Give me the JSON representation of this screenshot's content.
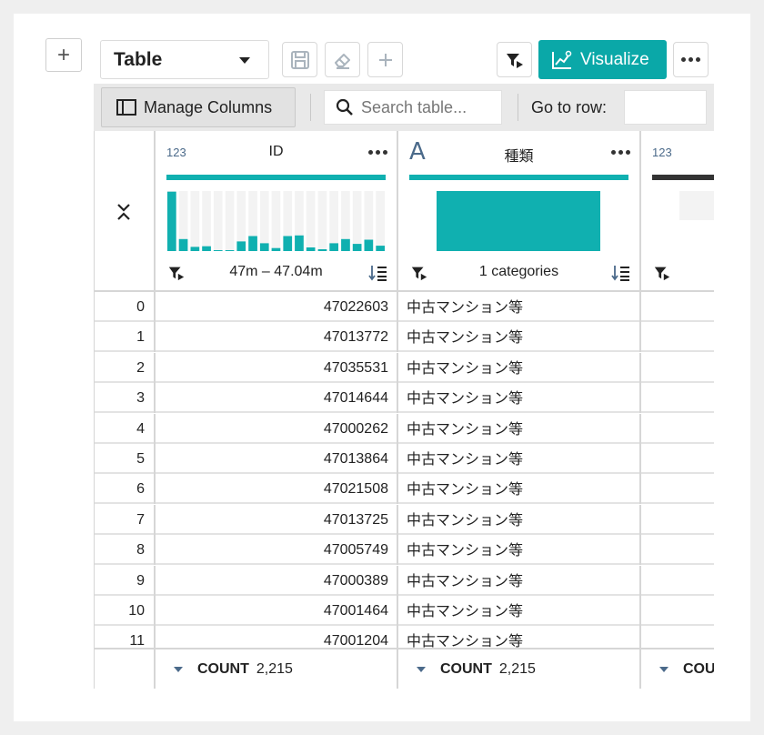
{
  "toolbar": {
    "add_cell_label": "+",
    "view_select": {
      "value": "Table"
    },
    "visualize_label": "Visualize"
  },
  "table_toolbar": {
    "manage_columns_label": "Manage Columns",
    "search_placeholder": "Search table...",
    "goto_label": "Go to row:",
    "goto_value": ""
  },
  "columns": [
    {
      "type_label": "123",
      "name": "ID",
      "summary": "47m – 47.04m",
      "histogram": [
        0.99,
        0.2,
        0.07,
        0.08,
        0.0,
        0.0,
        0.16,
        0.25,
        0.13,
        0.05,
        0.25,
        0.26,
        0.06,
        0.03,
        0.13,
        0.2,
        0.12,
        0.19,
        0.09
      ]
    },
    {
      "type_label": "A",
      "name": "種類",
      "summary": "1 categories"
    },
    {
      "type_label": "123"
    }
  ],
  "rows": [
    {
      "index": "0",
      "id": "47022603",
      "kind": "中古マンション等"
    },
    {
      "index": "1",
      "id": "47013772",
      "kind": "中古マンション等"
    },
    {
      "index": "2",
      "id": "47035531",
      "kind": "中古マンション等"
    },
    {
      "index": "3",
      "id": "47014644",
      "kind": "中古マンション等"
    },
    {
      "index": "4",
      "id": "47000262",
      "kind": "中古マンション等"
    },
    {
      "index": "5",
      "id": "47013864",
      "kind": "中古マンション等"
    },
    {
      "index": "6",
      "id": "47021508",
      "kind": "中古マンション等"
    },
    {
      "index": "7",
      "id": "47013725",
      "kind": "中古マンション等"
    },
    {
      "index": "8",
      "id": "47005749",
      "kind": "中古マンション等"
    },
    {
      "index": "9",
      "id": "47000389",
      "kind": "中古マンション等"
    },
    {
      "index": "10",
      "id": "47001464",
      "kind": "中古マンション等"
    },
    {
      "index": "11",
      "id": "47001204",
      "kind": "中古マンション等"
    }
  ],
  "footer": [
    {
      "label": "COUNT",
      "value": "2,215"
    },
    {
      "label": "COUNT",
      "value": "2,215"
    },
    {
      "label": "COU",
      "value": ""
    }
  ],
  "colors": {
    "accent": "#0aa8a8",
    "histogram": "#10b0b0",
    "type_icon": "#4b6a8a"
  }
}
